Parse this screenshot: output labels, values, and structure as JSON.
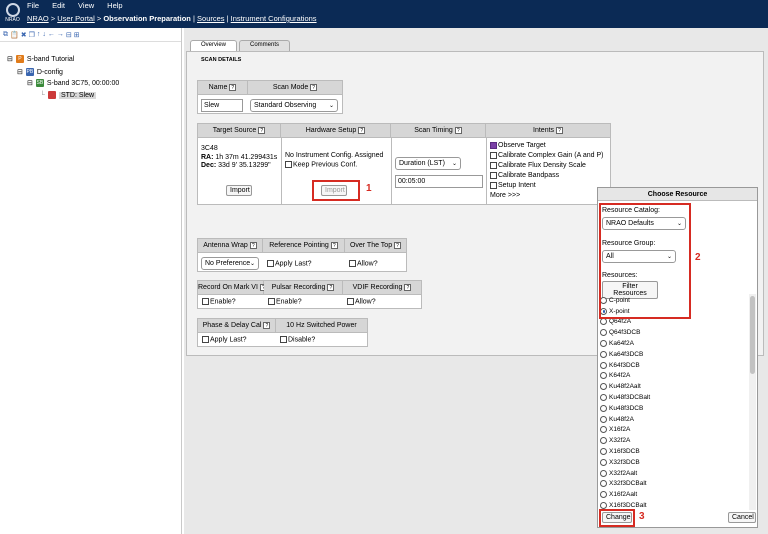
{
  "menu": [
    "File",
    "Edit",
    "View",
    "Help"
  ],
  "logo_text": "NRAO",
  "breadcrumb": {
    "items": [
      {
        "label": "NRAO",
        "link": true
      },
      {
        "label": "User Portal",
        "link": true
      },
      {
        "label": "Observation Preparation",
        "link": false
      },
      {
        "label": "Sources",
        "link": true
      },
      {
        "label": "Instrument Configurations",
        "link": true
      }
    ],
    "separator_main": ">",
    "separator_bar": "|"
  },
  "toolbar_icons": [
    "tree-tool-icons"
  ],
  "tree": {
    "items": [
      {
        "label": "S-band Tutorial",
        "badge": "P",
        "badge_color": "#e07b1a"
      },
      {
        "label": "D-config",
        "badge": "PB",
        "badge_color": "#3a66b0"
      },
      {
        "label": "S-band 3C75, 00:00:00",
        "badge": "SB",
        "badge_color": "#3b8a3b"
      },
      {
        "label": "STD: Slew",
        "badge": "",
        "badge_color": "#cc3a3a"
      }
    ]
  },
  "tabs": [
    {
      "label": "Overview"
    },
    {
      "label": "Comments"
    }
  ],
  "section_title": "SCAN DETAILS",
  "scan": {
    "name_header": "Name",
    "mode_header": "Scan Mode",
    "name_value": "Slew",
    "mode_value": "Standard Observing"
  },
  "source": {
    "header": "Target Source",
    "name": "3C48",
    "ra_label": "RA:",
    "ra_value": "1h 37m 41.299431s",
    "dec_label": "Dec:",
    "dec_value": "33d 9' 35.13299\"",
    "import_label": "Import"
  },
  "hardware": {
    "header": "Hardware Setup",
    "status": "No Instrument Config. Assigned",
    "keep_label": "Keep Previous Conf.",
    "import_label": "Import"
  },
  "timing": {
    "header": "Scan Timing",
    "mode": "Duration (LST)",
    "value": "00:05:00"
  },
  "intents": {
    "header": "Intents",
    "items": [
      {
        "label": "Observe Target",
        "checked": true
      },
      {
        "label": "Calibrate Complex Gain (A and P)",
        "checked": false
      },
      {
        "label": "Calibrate Flux Density Scale",
        "checked": false
      },
      {
        "label": "Calibrate Bandpass",
        "checked": false
      },
      {
        "label": "Setup Intent",
        "checked": false
      }
    ],
    "more": "More >>>"
  },
  "antenna": {
    "wrap_header": "Antenna Wrap",
    "wrap_value": "No Preference",
    "ref_header": "Reference Pointing",
    "ref_label": "Apply Last?",
    "over_header": "Over The Top",
    "over_label": "Allow?"
  },
  "recording": {
    "mark_header": "Record On Mark VI",
    "mark_label": "Enable?",
    "pulsar_header": "Pulsar Recording",
    "pulsar_label": "Enable?",
    "vdif_header": "VDIF Recording",
    "vdif_label": "Allow?"
  },
  "phase": {
    "phase_header": "Phase & Delay Cal",
    "phase_label": "Apply Last?",
    "power_header": "10 Hz Switched Power",
    "power_label": "Disable?"
  },
  "dialog": {
    "title": "Choose Resource",
    "catalog_label": "Resource Catalog:",
    "catalog_value": "NRAO Defaults",
    "group_label": "Resource Group:",
    "group_value": "All",
    "resources_label": "Resources:",
    "filter_label": "Filter Resources",
    "resources": [
      {
        "label": "C-point",
        "selected": false
      },
      {
        "label": "X-point",
        "selected": true
      },
      {
        "label": "Q64f2A",
        "selected": false
      },
      {
        "label": "Q64f3DCB",
        "selected": false
      },
      {
        "label": "Ka64f2A",
        "selected": false
      },
      {
        "label": "Ka64f3DCB",
        "selected": false
      },
      {
        "label": "K64f3DCB",
        "selected": false
      },
      {
        "label": "K64f2A",
        "selected": false
      },
      {
        "label": "Ku48f2Aalt",
        "selected": false
      },
      {
        "label": "Ku48f3DCBalt",
        "selected": false
      },
      {
        "label": "Ku48f3DCB",
        "selected": false
      },
      {
        "label": "Ku48f2A",
        "selected": false
      },
      {
        "label": "X16f2A",
        "selected": false
      },
      {
        "label": "X32f2A",
        "selected": false
      },
      {
        "label": "X16f3DCB",
        "selected": false
      },
      {
        "label": "X32f3DCB",
        "selected": false
      },
      {
        "label": "X32f2Aalt",
        "selected": false
      },
      {
        "label": "X32f3DCBalt",
        "selected": false
      },
      {
        "label": "X16f2Aalt",
        "selected": false
      },
      {
        "label": "X16f3DCBalt",
        "selected": false
      }
    ],
    "change_label": "Change",
    "cancel_label": "Cancel"
  },
  "annotations": [
    "1",
    "2",
    "3"
  ],
  "question_mark": "?",
  "accent_colors": {
    "topbar": "#0b2a55",
    "highlight": "#d62b22",
    "checked": "#7a3fa6"
  }
}
